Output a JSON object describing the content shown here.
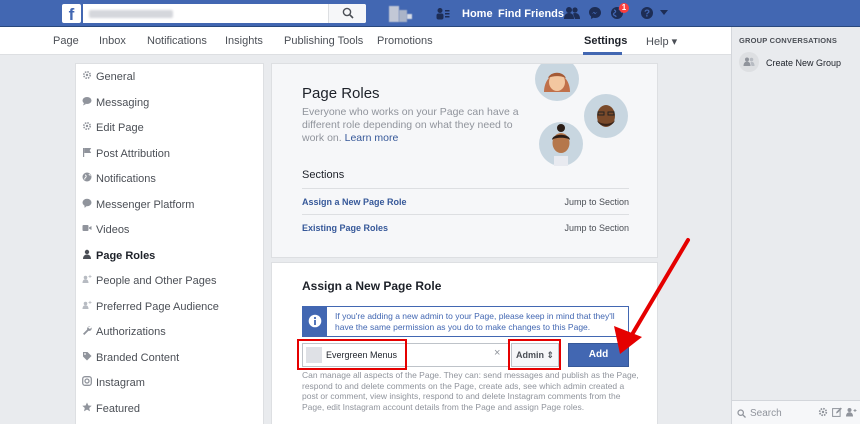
{
  "topbar": {
    "logo": "f",
    "home": "Home",
    "find_friends": "Find Friends",
    "notif_count": "1",
    "brand_color": "#4267b2"
  },
  "pagenav": {
    "items": [
      "Page",
      "Inbox",
      "Notifications",
      "Insights",
      "Publishing Tools",
      "Promotions"
    ],
    "settings": "Settings",
    "help": "Help ▾"
  },
  "leftmenu": {
    "items": [
      {
        "label": "General",
        "icon": "gear-icon"
      },
      {
        "label": "Messaging",
        "icon": "chat-icon"
      },
      {
        "label": "Edit Page",
        "icon": "gear-icon"
      },
      {
        "label": "Post Attribution",
        "icon": "flag-icon"
      },
      {
        "label": "Notifications",
        "icon": "globe-icon"
      },
      {
        "label": "Messenger Platform",
        "icon": "chat-icon"
      },
      {
        "label": "Videos",
        "icon": "video-icon"
      },
      {
        "label": "Page Roles",
        "icon": "person-icon"
      },
      {
        "label": "People and Other Pages",
        "icon": "people-icon"
      },
      {
        "label": "Preferred Page Audience",
        "icon": "people-icon"
      },
      {
        "label": "Authorizations",
        "icon": "wrench-icon"
      },
      {
        "label": "Branded Content",
        "icon": "tag-icon"
      },
      {
        "label": "Instagram",
        "icon": "instagram-icon"
      },
      {
        "label": "Featured",
        "icon": "star-icon"
      }
    ]
  },
  "roles": {
    "title": "Page Roles",
    "desc": "Everyone who works on your Page can have a different role depending on what they need to work on.",
    "learn_more": "Learn more",
    "sections_title": "Sections",
    "sections": [
      {
        "label": "Assign a New Page Role",
        "action": "Jump to Section"
      },
      {
        "label": "Existing Page Roles",
        "action": "Jump to Section"
      }
    ]
  },
  "assign": {
    "title": "Assign a New Page Role",
    "info": "If you're adding a new admin to your Page, please keep in mind that they'll have the same permission as you do to make changes to this Page.",
    "name_value": "Evergreen Menus",
    "clear": "×",
    "role": "Admin ⇕",
    "add": "Add",
    "perm": "Can manage all aspects of the Page. They can: send messages and publish as the Page, respond to and delete comments on the Page, create ads, see which admin created a post or comment, view insights, respond to and delete Instagram comments from the Page, edit Instagram account details from the Page and assign Page roles."
  },
  "chat": {
    "title": "GROUP CONVERSATIONS",
    "create": "Create New Group",
    "search": "Search"
  },
  "annotation_color": "#e50000"
}
